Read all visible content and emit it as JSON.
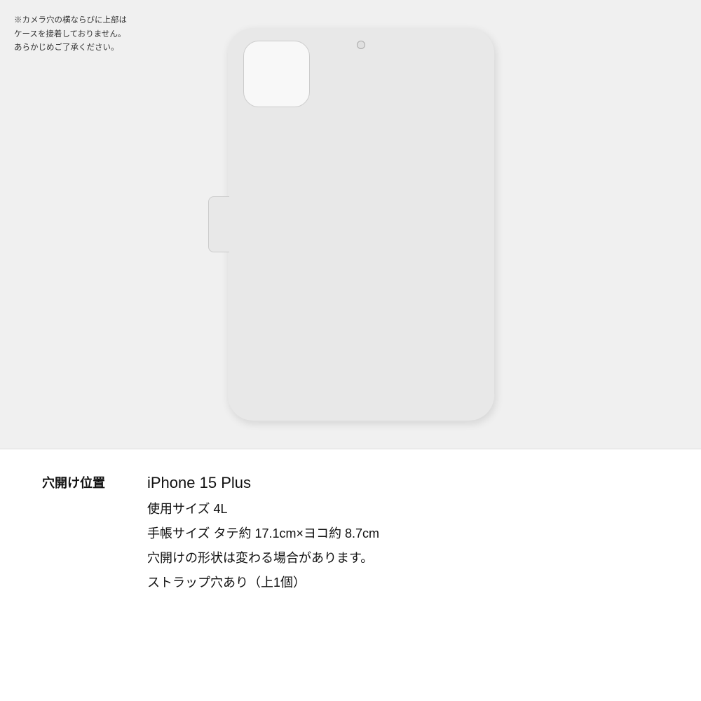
{
  "warning": {
    "text": "※カメラ穴の横ならびに上部は\nケースを接着しておりません。\nあらかじめご了承ください。"
  },
  "case": {
    "background_color": "#e8e8e8",
    "camera_cutout_color": "#f8f8f8"
  },
  "info": {
    "label": "穴開け位置",
    "model": "iPhone 15 Plus",
    "size_label": "使用サイズ 4L",
    "dimensions": "手帳サイズ タテ約 17.1cm×ヨコ約 8.7cm",
    "shape_note": "穴開けの形状は変わる場合があります。",
    "strap": "ストラップ穴あり（上1個）"
  }
}
